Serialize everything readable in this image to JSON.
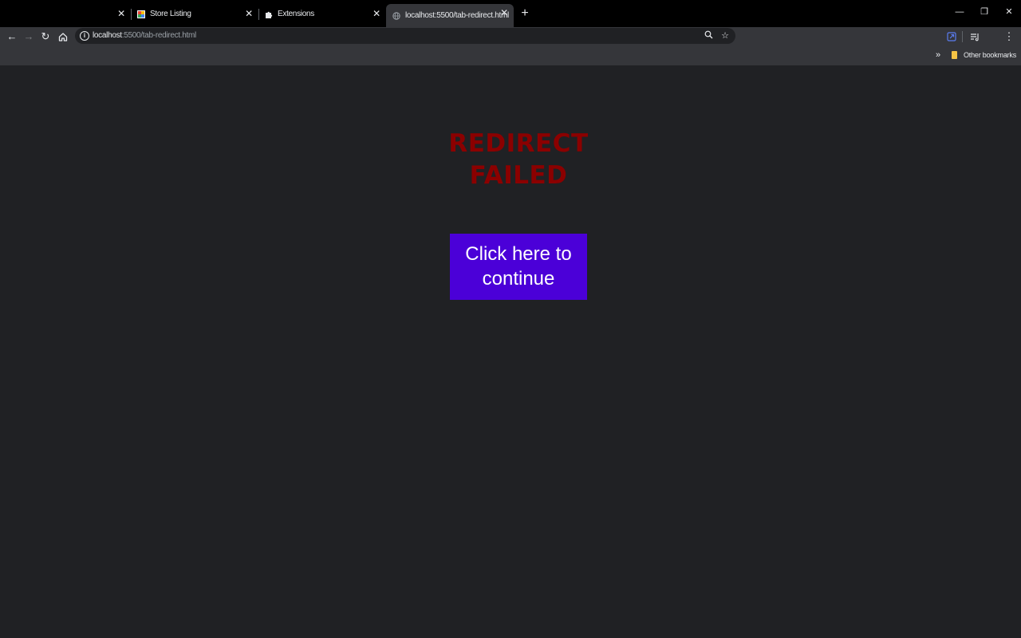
{
  "browser": {
    "tabs": [
      {
        "title": "",
        "favicon": "blank",
        "active": false
      },
      {
        "title": "Store Listing",
        "favicon": "store-icon",
        "active": false
      },
      {
        "title": "Extensions",
        "favicon": "puzzle-icon",
        "active": false
      },
      {
        "title": "localhost:5500/tab-redirect.html",
        "favicon": "globe-icon",
        "active": true
      }
    ],
    "new_tab_glyph": "+",
    "url_host": "localhost",
    "url_rest": ":5500/tab-redirect.html",
    "bookmarks": {
      "overflow_glyph": "»",
      "other_bookmarks_label": "Other bookmarks"
    }
  },
  "page": {
    "heading": "REDIRECT\nFAILED",
    "heading_color": "#8b0000",
    "button_label": "Click here to continue",
    "button_color": "#4b00d8",
    "background_color": "#202124"
  }
}
